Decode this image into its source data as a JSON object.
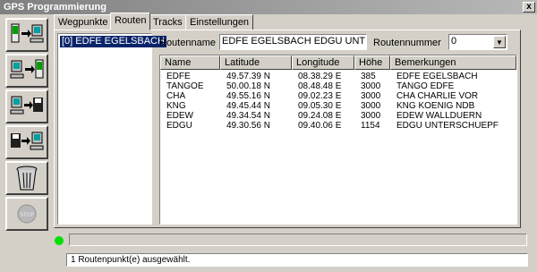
{
  "window": {
    "title": "GPS Programmierung",
    "close_label": "x"
  },
  "toolbar": {
    "buttons": [
      {
        "icon": "device-to-pc-icon"
      },
      {
        "icon": "pc-to-device-icon"
      },
      {
        "icon": "pc-to-disk-icon"
      },
      {
        "icon": "disk-to-pc-icon"
      },
      {
        "icon": "trash-icon"
      },
      {
        "icon": "stop-icon",
        "label": "STOP"
      }
    ]
  },
  "tabs": [
    {
      "label": "Wegpunkte"
    },
    {
      "label": "Routen"
    },
    {
      "label": "Tracks"
    },
    {
      "label": "Einstellungen"
    }
  ],
  "active_tab": "Routen",
  "routes": {
    "items": [
      {
        "label": "[0] EDFE EGELSBACH"
      }
    ],
    "name_label": "Routenname",
    "name_value": "EDFE EGELSBACH  EDGU UNTER",
    "number_label": "Routennummer",
    "number_value": "0"
  },
  "grid": {
    "columns": [
      {
        "label": "Name"
      },
      {
        "label": "Latitude"
      },
      {
        "label": "Longitude"
      },
      {
        "label": "Höhe"
      },
      {
        "label": "Bemerkungen"
      }
    ],
    "rows": [
      [
        "EDFE",
        "49.57.39 N",
        "08.38.29 E",
        "385",
        "EDFE EGELSBACH"
      ],
      [
        "TANGOE",
        "50.00.18 N",
        "08.48.48 E",
        "3000",
        "TANGO EDFE"
      ],
      [
        "CHA",
        "49.55.16 N",
        "09.02.23 E",
        "3000",
        "CHA CHARLIE VOR"
      ],
      [
        "KNG",
        "49.45.44 N",
        "09.05.30 E",
        "3000",
        "KNG KOENIG NDB"
      ],
      [
        "EDEW",
        "49.34.54 N",
        "09.24.08 E",
        "3000",
        "EDEW WALLDUERN"
      ],
      [
        "EDGU",
        "49.30.56 N",
        "09.40.06 E",
        "1154",
        "EDGU UNTERSCHUEPF"
      ]
    ]
  },
  "status": {
    "led_color": "#00e000",
    "progress": 0,
    "text": "1 Routenpunkt(e) ausgewählt."
  }
}
